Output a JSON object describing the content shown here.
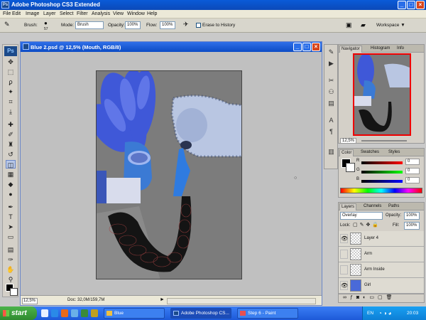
{
  "app": {
    "title": "Adobe Photoshop CS3 Extended",
    "logo": "Ps"
  },
  "menu": [
    "File",
    "Edit",
    "Image",
    "Layer",
    "Select",
    "Filter",
    "Analysis",
    "View",
    "Window",
    "Help"
  ],
  "options": {
    "brush_label": "Brush:",
    "brush_size": "57",
    "mode_label": "Mode:",
    "mode_value": "Brush",
    "opacity_label": "Opacity:",
    "opacity_value": "100%",
    "flow_label": "Flow:",
    "flow_value": "100%",
    "erase_history": "Erase to History",
    "workspace": "Workspace ▼"
  },
  "document": {
    "title": "Blue 2.psd @ 12,5% (Mouth, RGB/8)",
    "zoom": "12,5%",
    "doc_info": "Doc: 32,0M/159,7M"
  },
  "navigator": {
    "tabs": [
      "Navigator",
      "Histogram",
      "Info"
    ],
    "zoom": "12,5%"
  },
  "color": {
    "tabs": [
      "Color",
      "Swatches",
      "Styles"
    ],
    "channels": [
      {
        "label": "R",
        "value": "0"
      },
      {
        "label": "G",
        "value": "0"
      },
      {
        "label": "B",
        "value": "0"
      }
    ]
  },
  "layers": {
    "tabs": [
      "Layers",
      "Channels",
      "Paths"
    ],
    "blend_mode": "Overlay",
    "opacity_label": "Opacity:",
    "opacity": "100%",
    "lock_label": "Lock:",
    "fill_label": "Fill:",
    "fill": "100%",
    "items": [
      {
        "name": "Layer 4",
        "visible": true
      },
      {
        "name": "Arm",
        "visible": false
      },
      {
        "name": "Arm Inside",
        "visible": false
      },
      {
        "name": "Girl",
        "visible": true
      }
    ]
  },
  "taskbar": {
    "start": "start",
    "tasks": [
      "Blue",
      "Adobe Photoshop CS...",
      "Step 6 - Paint"
    ],
    "lang": "EN",
    "clock": "20:03"
  }
}
